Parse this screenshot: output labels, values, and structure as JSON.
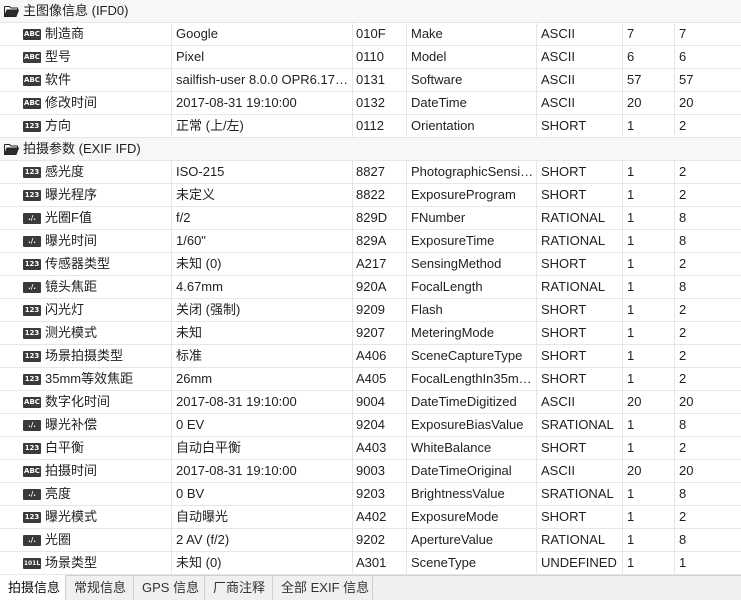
{
  "groups": [
    {
      "label": "主图像信息 (IFD0)",
      "rows": [
        {
          "icon": "ABC",
          "name": "制造商",
          "value": "Google",
          "tag": "010F",
          "key": "Make",
          "type": "ASCII",
          "count": "7",
          "size": "7"
        },
        {
          "icon": "ABC",
          "name": "型号",
          "value": "Pixel",
          "tag": "0110",
          "key": "Model",
          "type": "ASCII",
          "count": "6",
          "size": "6"
        },
        {
          "icon": "ABC",
          "name": "软件",
          "value": "sailfish-user 8.0.0 OPR6.17…",
          "tag": "0131",
          "key": "Software",
          "type": "ASCII",
          "count": "57",
          "size": "57"
        },
        {
          "icon": "ABC",
          "name": "修改时间",
          "value": "2017-08-31 19:10:00",
          "tag": "0132",
          "key": "DateTime",
          "type": "ASCII",
          "count": "20",
          "size": "20"
        },
        {
          "icon": "123",
          "name": "方向",
          "value": "正常 (上/左)",
          "tag": "0112",
          "key": "Orientation",
          "type": "SHORT",
          "count": "1",
          "size": "2"
        }
      ]
    },
    {
      "label": "拍摄参数 (EXIF IFD)",
      "rows": [
        {
          "icon": "123",
          "name": "感光度",
          "value": "ISO-215",
          "tag": "8827",
          "key": "PhotographicSensi…",
          "type": "SHORT",
          "count": "1",
          "size": "2"
        },
        {
          "icon": "123",
          "name": "曝光程序",
          "value": "未定义",
          "tag": "8822",
          "key": "ExposureProgram",
          "type": "SHORT",
          "count": "1",
          "size": "2"
        },
        {
          "icon": "./.",
          "name": "光圈F值",
          "value": "f/2",
          "tag": "829D",
          "key": "FNumber",
          "type": "RATIONAL",
          "count": "1",
          "size": "8"
        },
        {
          "icon": "./.",
          "name": "曝光时间",
          "value": "1/60\"",
          "tag": "829A",
          "key": "ExposureTime",
          "type": "RATIONAL",
          "count": "1",
          "size": "8"
        },
        {
          "icon": "123",
          "name": "传感器类型",
          "value": "未知 (0)",
          "tag": "A217",
          "key": "SensingMethod",
          "type": "SHORT",
          "count": "1",
          "size": "2"
        },
        {
          "icon": "./.",
          "name": "镜头焦距",
          "value": "4.67mm",
          "tag": "920A",
          "key": "FocalLength",
          "type": "RATIONAL",
          "count": "1",
          "size": "8"
        },
        {
          "icon": "123",
          "name": "闪光灯",
          "value": "关闭 (强制)",
          "tag": "9209",
          "key": "Flash",
          "type": "SHORT",
          "count": "1",
          "size": "2"
        },
        {
          "icon": "123",
          "name": "测光模式",
          "value": "未知",
          "tag": "9207",
          "key": "MeteringMode",
          "type": "SHORT",
          "count": "1",
          "size": "2"
        },
        {
          "icon": "123",
          "name": "场景拍摄类型",
          "value": "标准",
          "tag": "A406",
          "key": "SceneCaptureType",
          "type": "SHORT",
          "count": "1",
          "size": "2"
        },
        {
          "icon": "123",
          "name": "35mm等效焦距",
          "value": "26mm",
          "tag": "A405",
          "key": "FocalLengthIn35m…",
          "type": "SHORT",
          "count": "1",
          "size": "2"
        },
        {
          "icon": "ABC",
          "name": "数字化时间",
          "value": "2017-08-31 19:10:00",
          "tag": "9004",
          "key": "DateTimeDigitized",
          "type": "ASCII",
          "count": "20",
          "size": "20"
        },
        {
          "icon": "./.",
          "name": "曝光补偿",
          "value": "0 EV",
          "tag": "9204",
          "key": "ExposureBiasValue",
          "type": "SRATIONAL",
          "count": "1",
          "size": "8"
        },
        {
          "icon": "123",
          "name": "白平衡",
          "value": "自动白平衡",
          "tag": "A403",
          "key": "WhiteBalance",
          "type": "SHORT",
          "count": "1",
          "size": "2"
        },
        {
          "icon": "ABC",
          "name": "拍摄时间",
          "value": "2017-08-31 19:10:00",
          "tag": "9003",
          "key": "DateTimeOriginal",
          "type": "ASCII",
          "count": "20",
          "size": "20"
        },
        {
          "icon": "./.",
          "name": "亮度",
          "value": "0 BV",
          "tag": "9203",
          "key": "BrightnessValue",
          "type": "SRATIONAL",
          "count": "1",
          "size": "8"
        },
        {
          "icon": "123",
          "name": "曝光模式",
          "value": "自动曝光",
          "tag": "A402",
          "key": "ExposureMode",
          "type": "SHORT",
          "count": "1",
          "size": "2"
        },
        {
          "icon": "./.",
          "name": "光圈",
          "value": "2 AV (f/2)",
          "tag": "9202",
          "key": "ApertureValue",
          "type": "RATIONAL",
          "count": "1",
          "size": "8"
        },
        {
          "icon": "101L",
          "name": "场景类型",
          "value": "未知 (0)",
          "tag": "A301",
          "key": "SceneType",
          "type": "UNDEFINED",
          "count": "1",
          "size": "1"
        }
      ]
    }
  ],
  "tabs": [
    {
      "label": "拍摄信息",
      "active": true
    },
    {
      "label": "常规信息",
      "active": false
    },
    {
      "label": "GPS 信息",
      "active": false
    },
    {
      "label": "厂商注释",
      "active": false
    },
    {
      "label": "全部 EXIF 信息",
      "active": false
    }
  ]
}
